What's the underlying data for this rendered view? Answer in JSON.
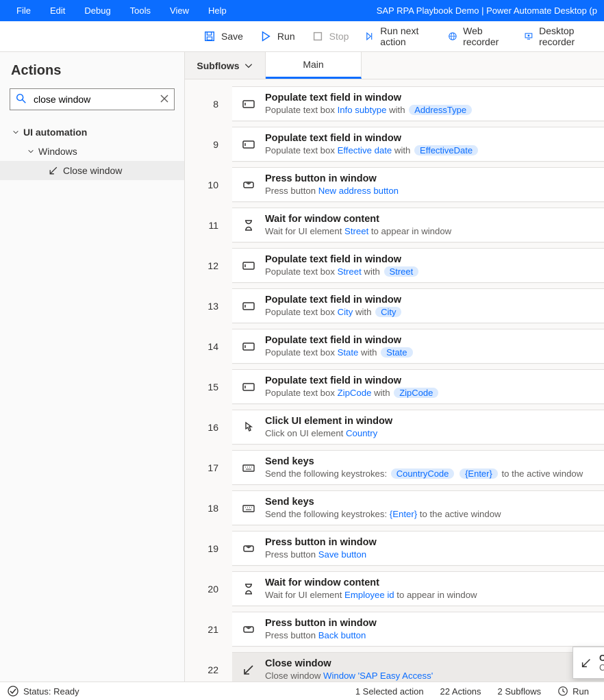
{
  "title": "SAP RPA Playbook Demo | Power Automate Desktop (p",
  "menu": {
    "file": "File",
    "edit": "Edit",
    "debug": "Debug",
    "tools": "Tools",
    "view": "View",
    "help": "Help"
  },
  "toolbar": {
    "save": "Save",
    "run": "Run",
    "stop": "Stop",
    "runnext": "Run next action",
    "web": "Web recorder",
    "desk": "Desktop recorder"
  },
  "sidebar": {
    "title": "Actions",
    "search_value": "close window",
    "tree": {
      "ui_automation": "UI automation",
      "windows": "Windows",
      "close_window": "Close window"
    }
  },
  "tabs": {
    "subflows": "Subflows",
    "main": "Main"
  },
  "steps": [
    {
      "n": "8",
      "icon": "textbox",
      "title": "Populate text field in window",
      "desc_prefix": "Populate text box ",
      "link": "Info subtype",
      "mid": " with ",
      "chip": "AddressType"
    },
    {
      "n": "9",
      "icon": "textbox",
      "title": "Populate text field in window",
      "desc_prefix": "Populate text box ",
      "link": "Effective date",
      "mid": " with ",
      "chip": "EffectiveDate"
    },
    {
      "n": "10",
      "icon": "press",
      "title": "Press button in window",
      "desc_prefix": "Press button ",
      "link": "New address button"
    },
    {
      "n": "11",
      "icon": "wait",
      "title": "Wait for window content",
      "desc_prefix": "Wait for UI element ",
      "link": "Street",
      "suffix": " to appear in window"
    },
    {
      "n": "12",
      "icon": "textbox",
      "title": "Populate text field in window",
      "desc_prefix": "Populate text box ",
      "link": "Street",
      "mid": " with ",
      "chip": "Street"
    },
    {
      "n": "13",
      "icon": "textbox",
      "title": "Populate text field in window",
      "desc_prefix": "Populate text box ",
      "link": "City",
      "mid": " with ",
      "chip": "City"
    },
    {
      "n": "14",
      "icon": "textbox",
      "title": "Populate text field in window",
      "desc_prefix": "Populate text box ",
      "link": "State",
      "mid": " with ",
      "chip": "State"
    },
    {
      "n": "15",
      "icon": "textbox",
      "title": "Populate text field in window",
      "desc_prefix": "Populate text box ",
      "link": "ZipCode",
      "mid": " with ",
      "chip": "ZipCode"
    },
    {
      "n": "16",
      "icon": "click",
      "title": "Click UI element in window",
      "desc_prefix": "Click on UI element ",
      "link": "Country"
    },
    {
      "n": "17",
      "icon": "keys",
      "title": "Send keys",
      "desc_prefix": "Send the following keystrokes: ",
      "chip": "CountryCode",
      "chip2": "{Enter}",
      "suffix": " to the active window"
    },
    {
      "n": "18",
      "icon": "keys",
      "title": "Send keys",
      "desc_prefix": "Send the following keystrokes: ",
      "link": "{Enter}",
      "suffix": " to the active window"
    },
    {
      "n": "19",
      "icon": "press",
      "title": "Press button in window",
      "desc_prefix": "Press button ",
      "link": "Save button"
    },
    {
      "n": "20",
      "icon": "wait",
      "title": "Wait for window content",
      "desc_prefix": "Wait for UI element ",
      "link": "Employee id",
      "suffix": " to appear in window"
    },
    {
      "n": "21",
      "icon": "press",
      "title": "Press button in window",
      "desc_prefix": "Press button ",
      "link": "Back button"
    },
    {
      "n": "22",
      "icon": "close",
      "title": "Close window",
      "desc_prefix": "Close window ",
      "link": "Window 'SAP Easy Access'",
      "selected": true
    }
  ],
  "tooltip": {
    "title": "Close window",
    "sub": "Close window"
  },
  "status": {
    "ready": "Status: Ready",
    "selected": "1 Selected action",
    "actions": "22 Actions",
    "subflows": "2 Subflows",
    "run": "Run"
  }
}
